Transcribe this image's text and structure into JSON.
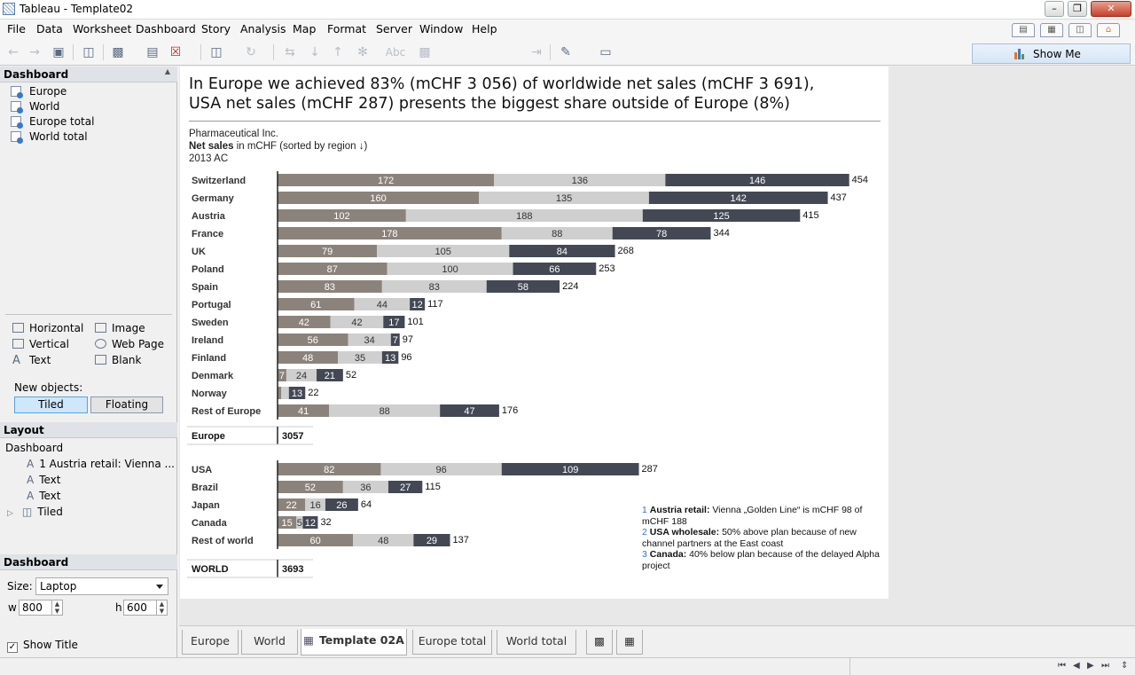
{
  "window": {
    "title": "Tableau - Template02"
  },
  "menu": [
    "File",
    "Data",
    "Worksheet",
    "Dashboard",
    "Story",
    "Analysis",
    "Map",
    "Format",
    "Server",
    "Window",
    "Help"
  ],
  "toolbar": {
    "abc_label": "Abc",
    "show_me_label": "Show Me"
  },
  "left_pane": {
    "dashboard_header": "Dashboard",
    "sheets": [
      "Europe",
      "World",
      "Europe total",
      "World total"
    ],
    "objects": [
      {
        "label": "Horizontal",
        "icon": "horizontal-icon"
      },
      {
        "label": "Image",
        "icon": "image-icon"
      },
      {
        "label": "Vertical",
        "icon": "vertical-icon"
      },
      {
        "label": "Web Page",
        "icon": "web-page-icon"
      },
      {
        "label": "Text",
        "icon": "text-icon"
      },
      {
        "label": "Blank",
        "icon": "blank-icon"
      }
    ],
    "new_objects_label": "New objects:",
    "tiled_label": "Tiled",
    "floating_label": "Floating",
    "layout_header": "Layout",
    "layout_items": [
      "Dashboard",
      "1 Austria retail: Vienna ...",
      "Text",
      "Text",
      "Tiled"
    ],
    "dashboard_header2": "Dashboard",
    "size_label": "Size:",
    "size_value": "Laptop",
    "w_label": "w",
    "w_value": "800",
    "h_label": "h",
    "h_value": "600",
    "show_title_label": "Show Title"
  },
  "dashboard": {
    "headline_line1": "In Europe we achieved 83% (mCHF 3 056) of worldwide net sales (mCHF 3 691),",
    "headline_line2": "USA net sales (mCHF 287) presents the biggest share outside of Europe (8%)",
    "company": "Pharmaceutical Inc.",
    "measure_bold": "Net sales",
    "measure_rest": " in mCHF (sorted by region ↓)",
    "period": "2013 AC",
    "footnotes": [
      {
        "num": "1",
        "bold": "Austria retail:",
        "text": " Vienna „Golden Line“ is mCHF 98 of mCHF 188"
      },
      {
        "num": "2",
        "bold": "USA wholesale:",
        "text": " 50% above plan because of new channel partners at the East coast"
      },
      {
        "num": "3",
        "bold": " Canada:",
        "text": " 40% below plan because of the delayed Alpha project"
      }
    ]
  },
  "chart_data": {
    "type": "bar",
    "stacked": true,
    "orientation": "horizontal",
    "colors": [
      "#8b827b",
      "#cfcfcf",
      "#434854"
    ],
    "groups": [
      {
        "categories": [
          "Switzerland",
          "Germany",
          "Austria",
          "France",
          "UK",
          "Poland",
          "Spain",
          "Portugal",
          "Sweden",
          "Ireland",
          "Finland",
          "Denmark",
          "Norway",
          "Rest of Europe"
        ],
        "series": [
          {
            "values": [
              172,
              160,
              102,
              178,
              79,
              87,
              83,
              61,
              42,
              56,
              48,
              7,
              3,
              41
            ]
          },
          {
            "values": [
              136,
              135,
              188,
              88,
              105,
              100,
              83,
              44,
              42,
              34,
              35,
              24,
              6,
              88
            ]
          },
          {
            "values": [
              146,
              142,
              125,
              78,
              84,
              66,
              58,
              12,
              17,
              7,
              13,
              21,
              13,
              47
            ]
          }
        ],
        "totals": [
          454,
          437,
          415,
          344,
          268,
          253,
          224,
          117,
          101,
          97,
          96,
          52,
          22,
          176
        ],
        "segment_labels": [
          [
            "172",
            "136",
            "146"
          ],
          [
            "160",
            "135",
            "142"
          ],
          [
            "102",
            "188",
            "125"
          ],
          [
            "178",
            "88",
            "78"
          ],
          [
            "79",
            "105",
            "84"
          ],
          [
            "87",
            "100",
            "66"
          ],
          [
            "83",
            "83",
            "58"
          ],
          [
            "61",
            "44",
            "12"
          ],
          [
            "42",
            "42",
            "17"
          ],
          [
            "56",
            "34",
            "7"
          ],
          [
            "48",
            "35",
            "13"
          ],
          [
            "7",
            "24",
            "21"
          ],
          [
            "",
            "",
            "13"
          ],
          [
            "41",
            "88",
            "47"
          ]
        ],
        "summary_label": "Europe",
        "summary_value": "3057"
      },
      {
        "categories": [
          "USA",
          "Brazil",
          "Japan",
          "Canada",
          "Rest of world"
        ],
        "series": [
          {
            "values": [
              82,
              52,
              22,
              15,
              60
            ]
          },
          {
            "values": [
              96,
              36,
              16,
              5,
              48
            ]
          },
          {
            "values": [
              109,
              27,
              26,
              12,
              29
            ]
          }
        ],
        "totals": [
          287,
          115,
          64,
          32,
          137
        ],
        "segment_labels": [
          [
            "82",
            "96",
            "109"
          ],
          [
            "52",
            "36",
            "27"
          ],
          [
            "22",
            "16",
            "26"
          ],
          [
            "15",
            "5",
            "12"
          ],
          [
            "60",
            "48",
            "29"
          ]
        ],
        "summary_label": "WORLD",
        "summary_value": "3693"
      }
    ]
  },
  "sheet_tabs": [
    "Europe",
    "World",
    "Template 02A",
    "Europe total",
    "World total"
  ],
  "active_tab": "Template 02A"
}
